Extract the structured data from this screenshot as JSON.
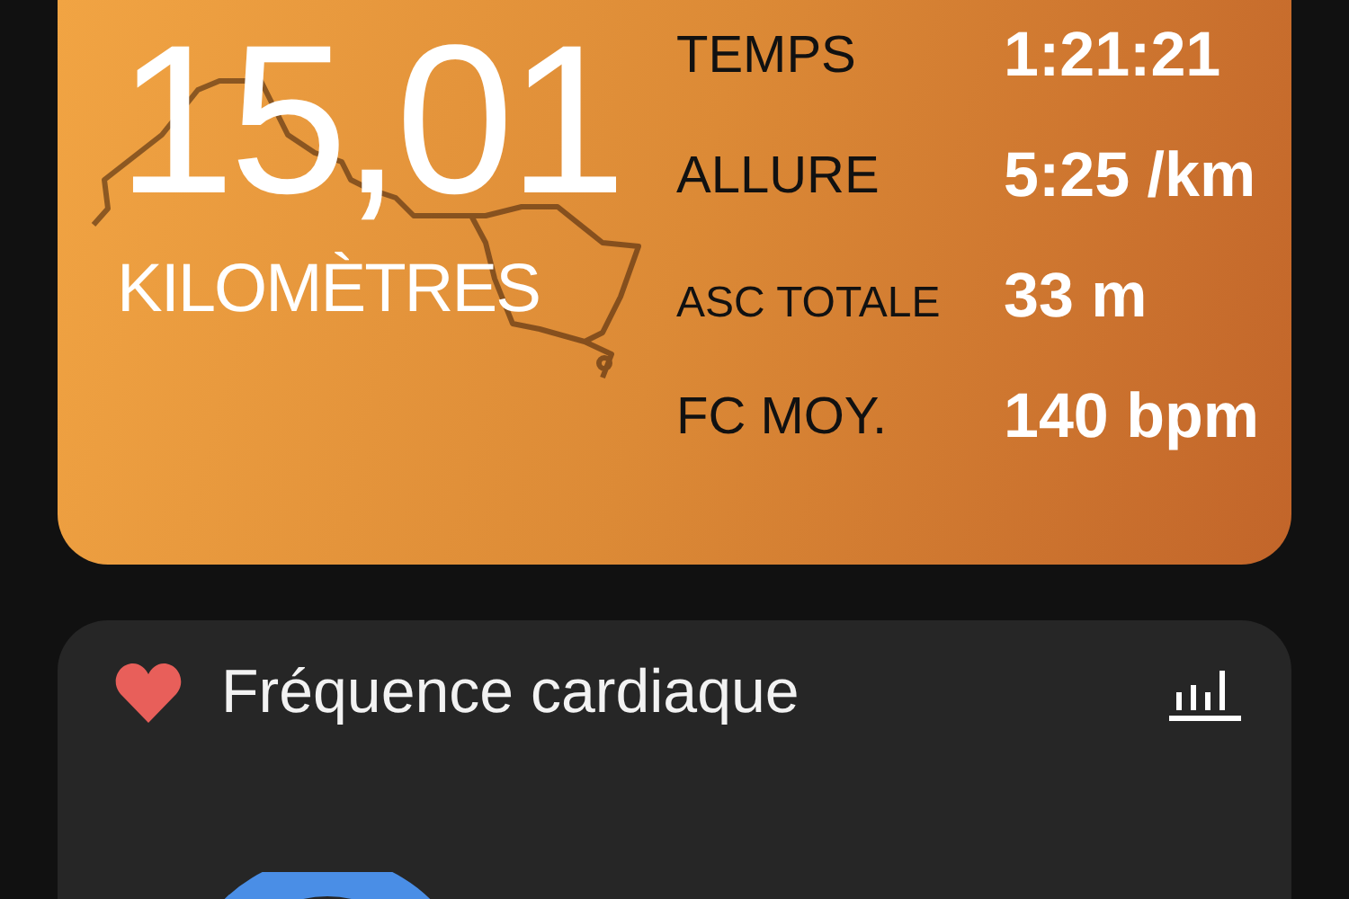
{
  "summary": {
    "distance": "15,01",
    "unit": "KILOMÈTRES",
    "stats": [
      {
        "label": "TEMPS",
        "value": "1:21:21"
      },
      {
        "label": "ALLURE",
        "value": "5:25 /km"
      },
      {
        "label": "ASC TOTALE",
        "value": "33 m"
      },
      {
        "label": "FC MOY.",
        "value": "140 bpm"
      }
    ]
  },
  "heart_rate": {
    "title": "Fréquence cardiaque"
  }
}
